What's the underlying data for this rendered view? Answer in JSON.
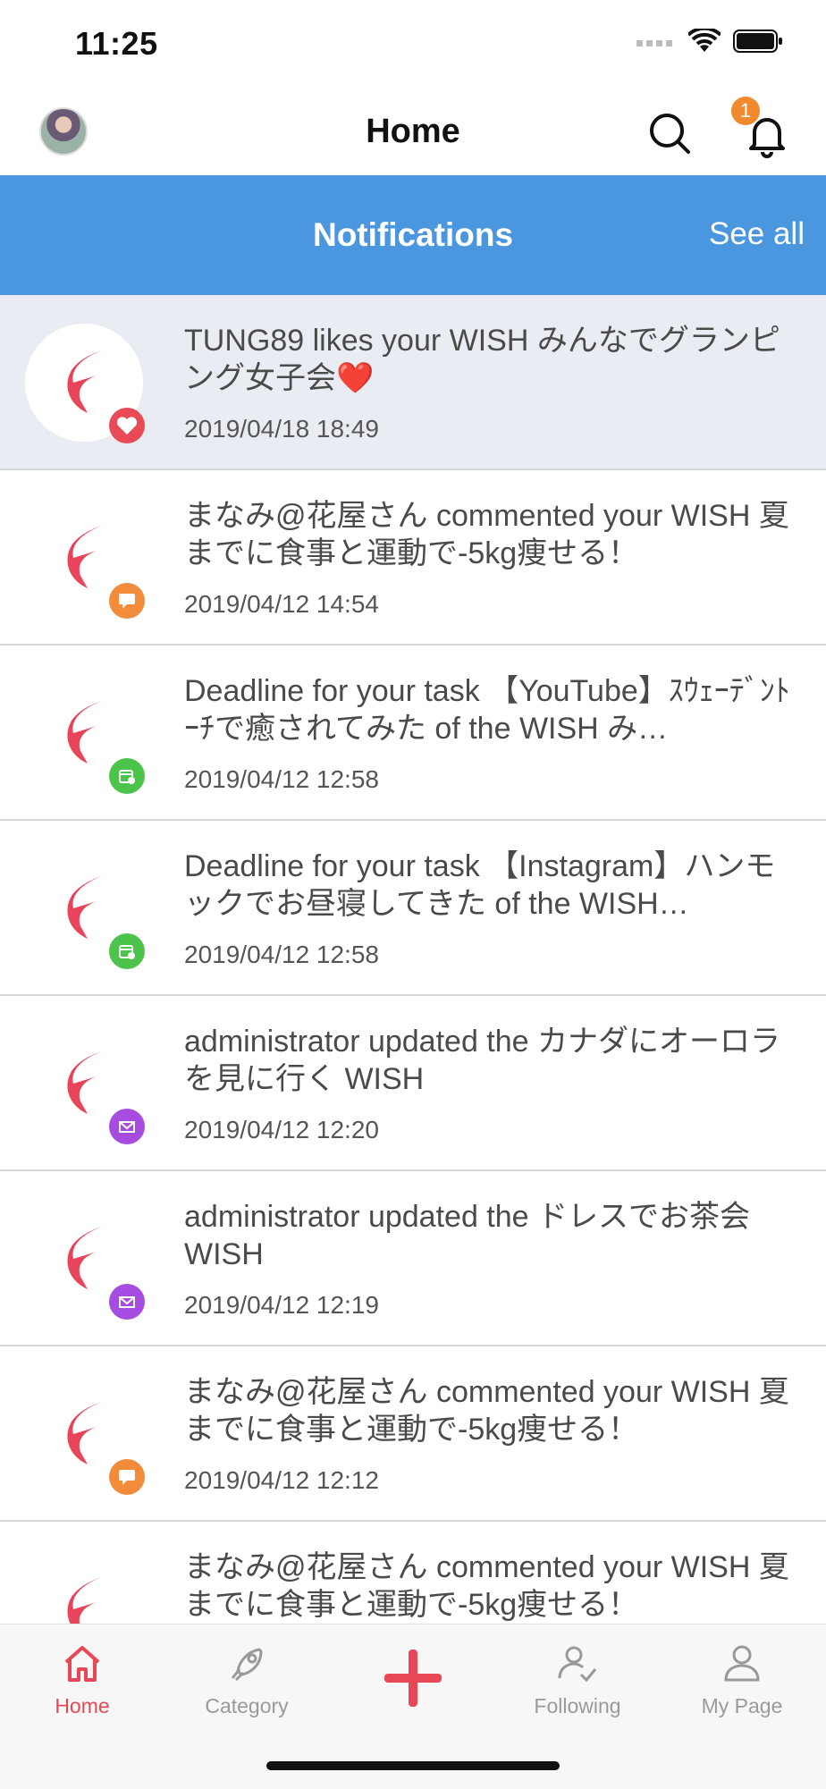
{
  "status": {
    "time": "11:25"
  },
  "nav": {
    "title": "Home",
    "bell_count": "1"
  },
  "notifications": {
    "title": "Notifications",
    "see_all": "See all"
  },
  "items": [
    {
      "text": "TUNG89 likes your WISH みんなでグランピング女子会❤️",
      "date": "2019/04/18 18:49",
      "badge": "heart-icon",
      "badge_color": "#e84a56"
    },
    {
      "text": "まなみ@花屋さん commented your WISH 夏までに食事と運動で-5kg痩せる！",
      "date": "2019/04/12 14:54",
      "badge": "comment-icon",
      "badge_color": "#f28b3a"
    },
    {
      "text": "Deadline for your task 【YouTube】ｽｳｪｰﾃﾞﾝﾄｰﾁで癒されてみた of the WISH み…",
      "date": "2019/04/12 12:58",
      "badge": "calendar-icon",
      "badge_color": "#4cc44c"
    },
    {
      "text": "Deadline for your task 【Instagram】ハンモックでお昼寝してきた of the WISH…",
      "date": "2019/04/12 12:58",
      "badge": "calendar-icon",
      "badge_color": "#4cc44c"
    },
    {
      "text": "administrator updated the カナダにオーロラを見に行く WISH",
      "date": "2019/04/12 12:20",
      "badge": "mail-icon",
      "badge_color": "#a64ce0"
    },
    {
      "text": "administrator updated the ドレスでお茶会 WISH",
      "date": "2019/04/12 12:19",
      "badge": "mail-icon",
      "badge_color": "#a64ce0"
    },
    {
      "text": "まなみ@花屋さん commented your WISH 夏までに食事と運動で-5kg痩せる！",
      "date": "2019/04/12 12:12",
      "badge": "comment-icon",
      "badge_color": "#f28b3a"
    },
    {
      "text": "まなみ@花屋さん commented your WISH 夏までに食事と運動で-5kg痩せる！",
      "date": "",
      "badge": "comment-icon",
      "badge_color": "#f28b3a"
    }
  ],
  "tabs": {
    "home": "Home",
    "category": "Category",
    "following": "Following",
    "mypage": "My Page"
  },
  "colors": {
    "accent": "#e84855",
    "header_blue": "#4a97df"
  }
}
